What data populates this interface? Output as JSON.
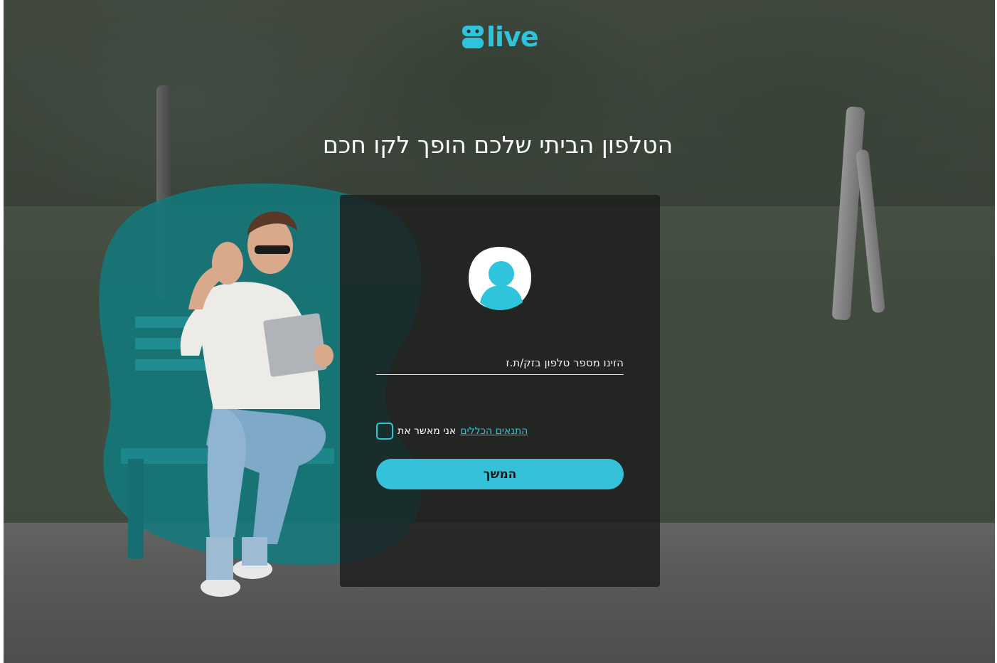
{
  "brand": {
    "logo_text": "live",
    "accent": "#2ec4dc"
  },
  "headline": "הטלפון הביתי שלכם הופך לקו חכם",
  "login_card": {
    "avatar_icon": "user-avatar-icon",
    "phone_placeholder": "הזינו מספר טלפון בזק/ת.ז",
    "phone_value": "",
    "terms_prefix": "אני מאשר את",
    "terms_link": "התנאים הכללים",
    "terms_checked": false,
    "continue_label": "המשך"
  },
  "colors": {
    "button": "#34c1d9",
    "card": "#1c1c1c",
    "blob": "#137a7f"
  }
}
